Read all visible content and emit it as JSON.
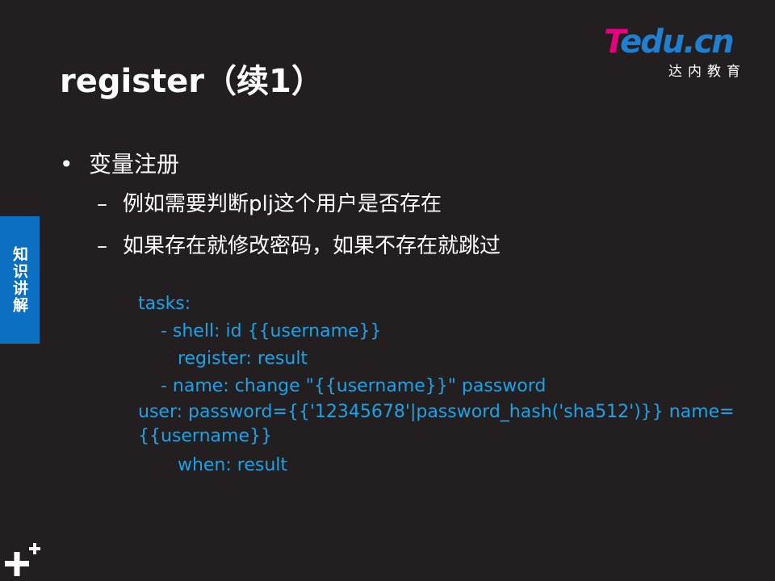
{
  "title": "register（续1）",
  "logo": {
    "brand_t": "T",
    "brand_rest": "edu.cn",
    "subtitle": "达内教育"
  },
  "side_tab": {
    "label": "知识讲解"
  },
  "bullets": {
    "level1": {
      "marker": "•",
      "text": "变量注册"
    },
    "level2": [
      {
        "marker": "–",
        "text": "例如需要判断plj这个用户是否存在"
      },
      {
        "marker": "–",
        "text": "如果存在就修改密码，如果不存在就跳过"
      }
    ]
  },
  "code": {
    "lines": [
      "tasks:",
      "    - shell: id {{username}}",
      "       register: result",
      "    - name: change \"{{username}}\" password",
      "       user: password={{'12345678'|password_hash('sha512')}} name={{username}}",
      "       when: result"
    ]
  },
  "colors": {
    "background": "#231f20",
    "code": "#1aa3e8",
    "side_tab": "#0b6fc2",
    "logo_t": "#e4007f",
    "logo_rest": "#1f7fd0"
  },
  "icons": {
    "corner": "plus-plus-icon"
  }
}
